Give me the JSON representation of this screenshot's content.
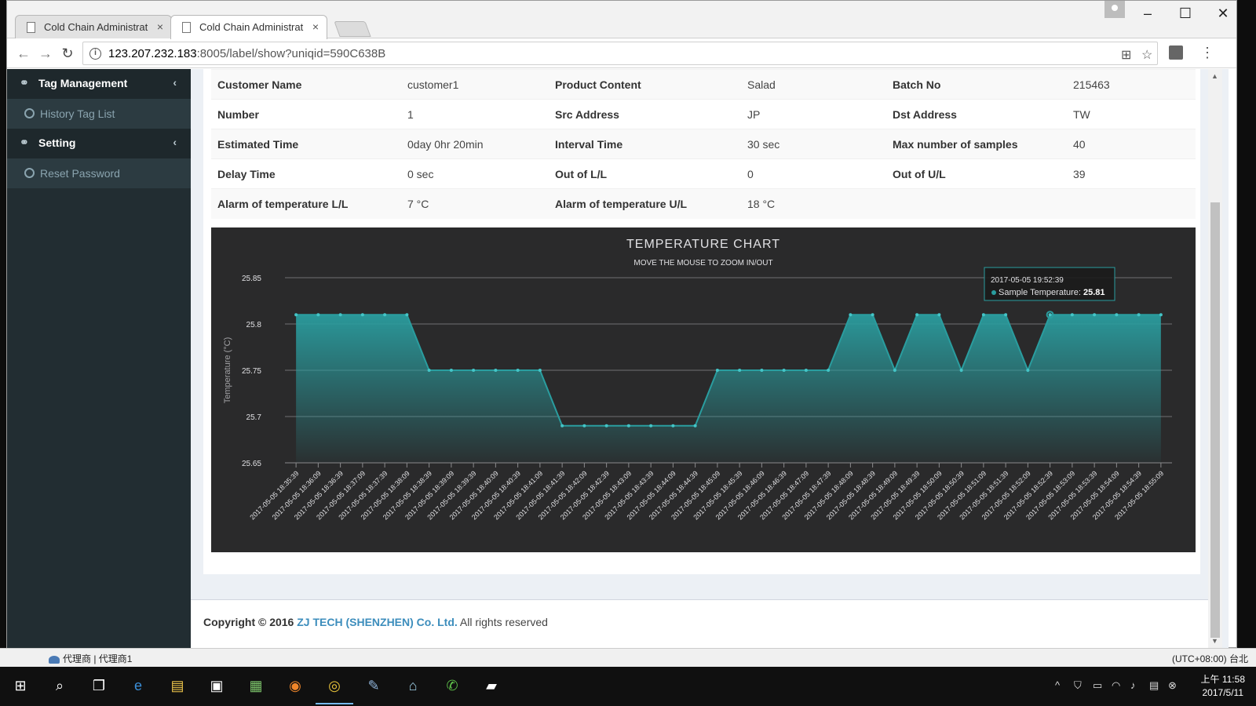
{
  "browser": {
    "tabs": [
      {
        "title": "Cold Chain Administrat",
        "active": false
      },
      {
        "title": "Cold Chain Administrat",
        "active": true
      }
    ],
    "url_host": "123.207.232.183",
    "url_rest": ":8005/label/show?uniqid=590C638B"
  },
  "sidebar": {
    "items": [
      {
        "label": "Tag Management",
        "type": "header"
      },
      {
        "label": "History Tag List",
        "type": "sub"
      },
      {
        "label": "Setting",
        "type": "header"
      },
      {
        "label": "Reset Password",
        "type": "sub"
      }
    ]
  },
  "details": {
    "rows": [
      [
        {
          "label": "Customer Name",
          "value": "customer1"
        },
        {
          "label": "Product Content",
          "value": "Salad"
        },
        {
          "label": "Batch No",
          "value": "215463"
        }
      ],
      [
        {
          "label": "Number",
          "value": "1"
        },
        {
          "label": "Src Address",
          "value": "JP"
        },
        {
          "label": "Dst Address",
          "value": "TW"
        }
      ],
      [
        {
          "label": "Estimated Time",
          "value": "0day 0hr 20min"
        },
        {
          "label": "Interval Time",
          "value": "30 sec"
        },
        {
          "label": "Max number of samples",
          "value": "40"
        }
      ],
      [
        {
          "label": "Delay Time",
          "value": "0 sec"
        },
        {
          "label": "Out of L/L",
          "value": "0"
        },
        {
          "label": "Out of U/L",
          "value": "39"
        }
      ],
      [
        {
          "label": "Alarm of temperature L/L",
          "value": "7 °C"
        },
        {
          "label": "Alarm of temperature U/L",
          "value": "18 °C"
        },
        {
          "label": "",
          "value": ""
        }
      ]
    ]
  },
  "chart_data": {
    "type": "area",
    "title": "TEMPERATURE CHART",
    "subtitle": "MOVE THE MOUSE TO ZOOM IN/OUT",
    "ylabel": "Temperature (°C)",
    "xlabel": "",
    "y_ticks": [
      "25.85",
      "25.8",
      "25.75",
      "25.7",
      "25.65"
    ],
    "ylim": [
      25.65,
      25.85
    ],
    "grid": true,
    "x": [
      "2017-05-05 18:35:39",
      "2017-05-05 18:36:09",
      "2017-05-05 18:36:39",
      "2017-05-05 18:37:09",
      "2017-05-05 18:37:39",
      "2017-05-05 18:38:09",
      "2017-05-05 18:38:39",
      "2017-05-05 18:39:09",
      "2017-05-05 18:39:39",
      "2017-05-05 18:40:09",
      "2017-05-05 18:40:39",
      "2017-05-05 18:41:09",
      "2017-05-05 18:41:39",
      "2017-05-05 18:42:09",
      "2017-05-05 18:42:39",
      "2017-05-05 18:43:09",
      "2017-05-05 18:43:39",
      "2017-05-05 18:44:09",
      "2017-05-05 18:44:39",
      "2017-05-05 18:45:09",
      "2017-05-05 18:45:39",
      "2017-05-05 18:46:09",
      "2017-05-05 18:46:39",
      "2017-05-05 18:47:09",
      "2017-05-05 18:47:39",
      "2017-05-05 18:48:09",
      "2017-05-05 18:48:39",
      "2017-05-05 18:49:09",
      "2017-05-05 18:49:39",
      "2017-05-05 18:50:09",
      "2017-05-05 18:50:39",
      "2017-05-05 18:51:09",
      "2017-05-05 18:51:39",
      "2017-05-05 18:52:09",
      "2017-05-05 18:52:39",
      "2017-05-05 18:53:09",
      "2017-05-05 18:53:39",
      "2017-05-05 18:54:09",
      "2017-05-05 18:54:39",
      "2017-05-05 18:55:09"
    ],
    "series": [
      {
        "name": "Sample Temperature",
        "color": "#2a9d9f",
        "values": [
          25.81,
          25.81,
          25.81,
          25.81,
          25.81,
          25.81,
          25.75,
          25.75,
          25.75,
          25.75,
          25.75,
          25.75,
          25.69,
          25.69,
          25.69,
          25.69,
          25.69,
          25.69,
          25.69,
          25.75,
          25.75,
          25.75,
          25.75,
          25.75,
          25.75,
          25.81,
          25.81,
          25.75,
          25.81,
          25.81,
          25.75,
          25.81,
          25.81,
          25.75,
          25.81,
          25.81,
          25.81,
          25.81,
          25.81,
          25.81
        ]
      }
    ],
    "tooltip": {
      "time": "2017-05-05 19:52:39",
      "label": "Sample Temperature:",
      "value": "25.81"
    }
  },
  "footer": {
    "prefix": "Copyright © 2016",
    "company": "ZJ TECH (SHENZHEN) Co. Ltd.",
    "suffix": "All rights reserved"
  },
  "status_strip": {
    "left": "代理商 | 代理商1",
    "right": "(UTC+08:00) 台北"
  },
  "taskbar": {
    "time": "上午 11:58",
    "date": "2017/5/11"
  }
}
